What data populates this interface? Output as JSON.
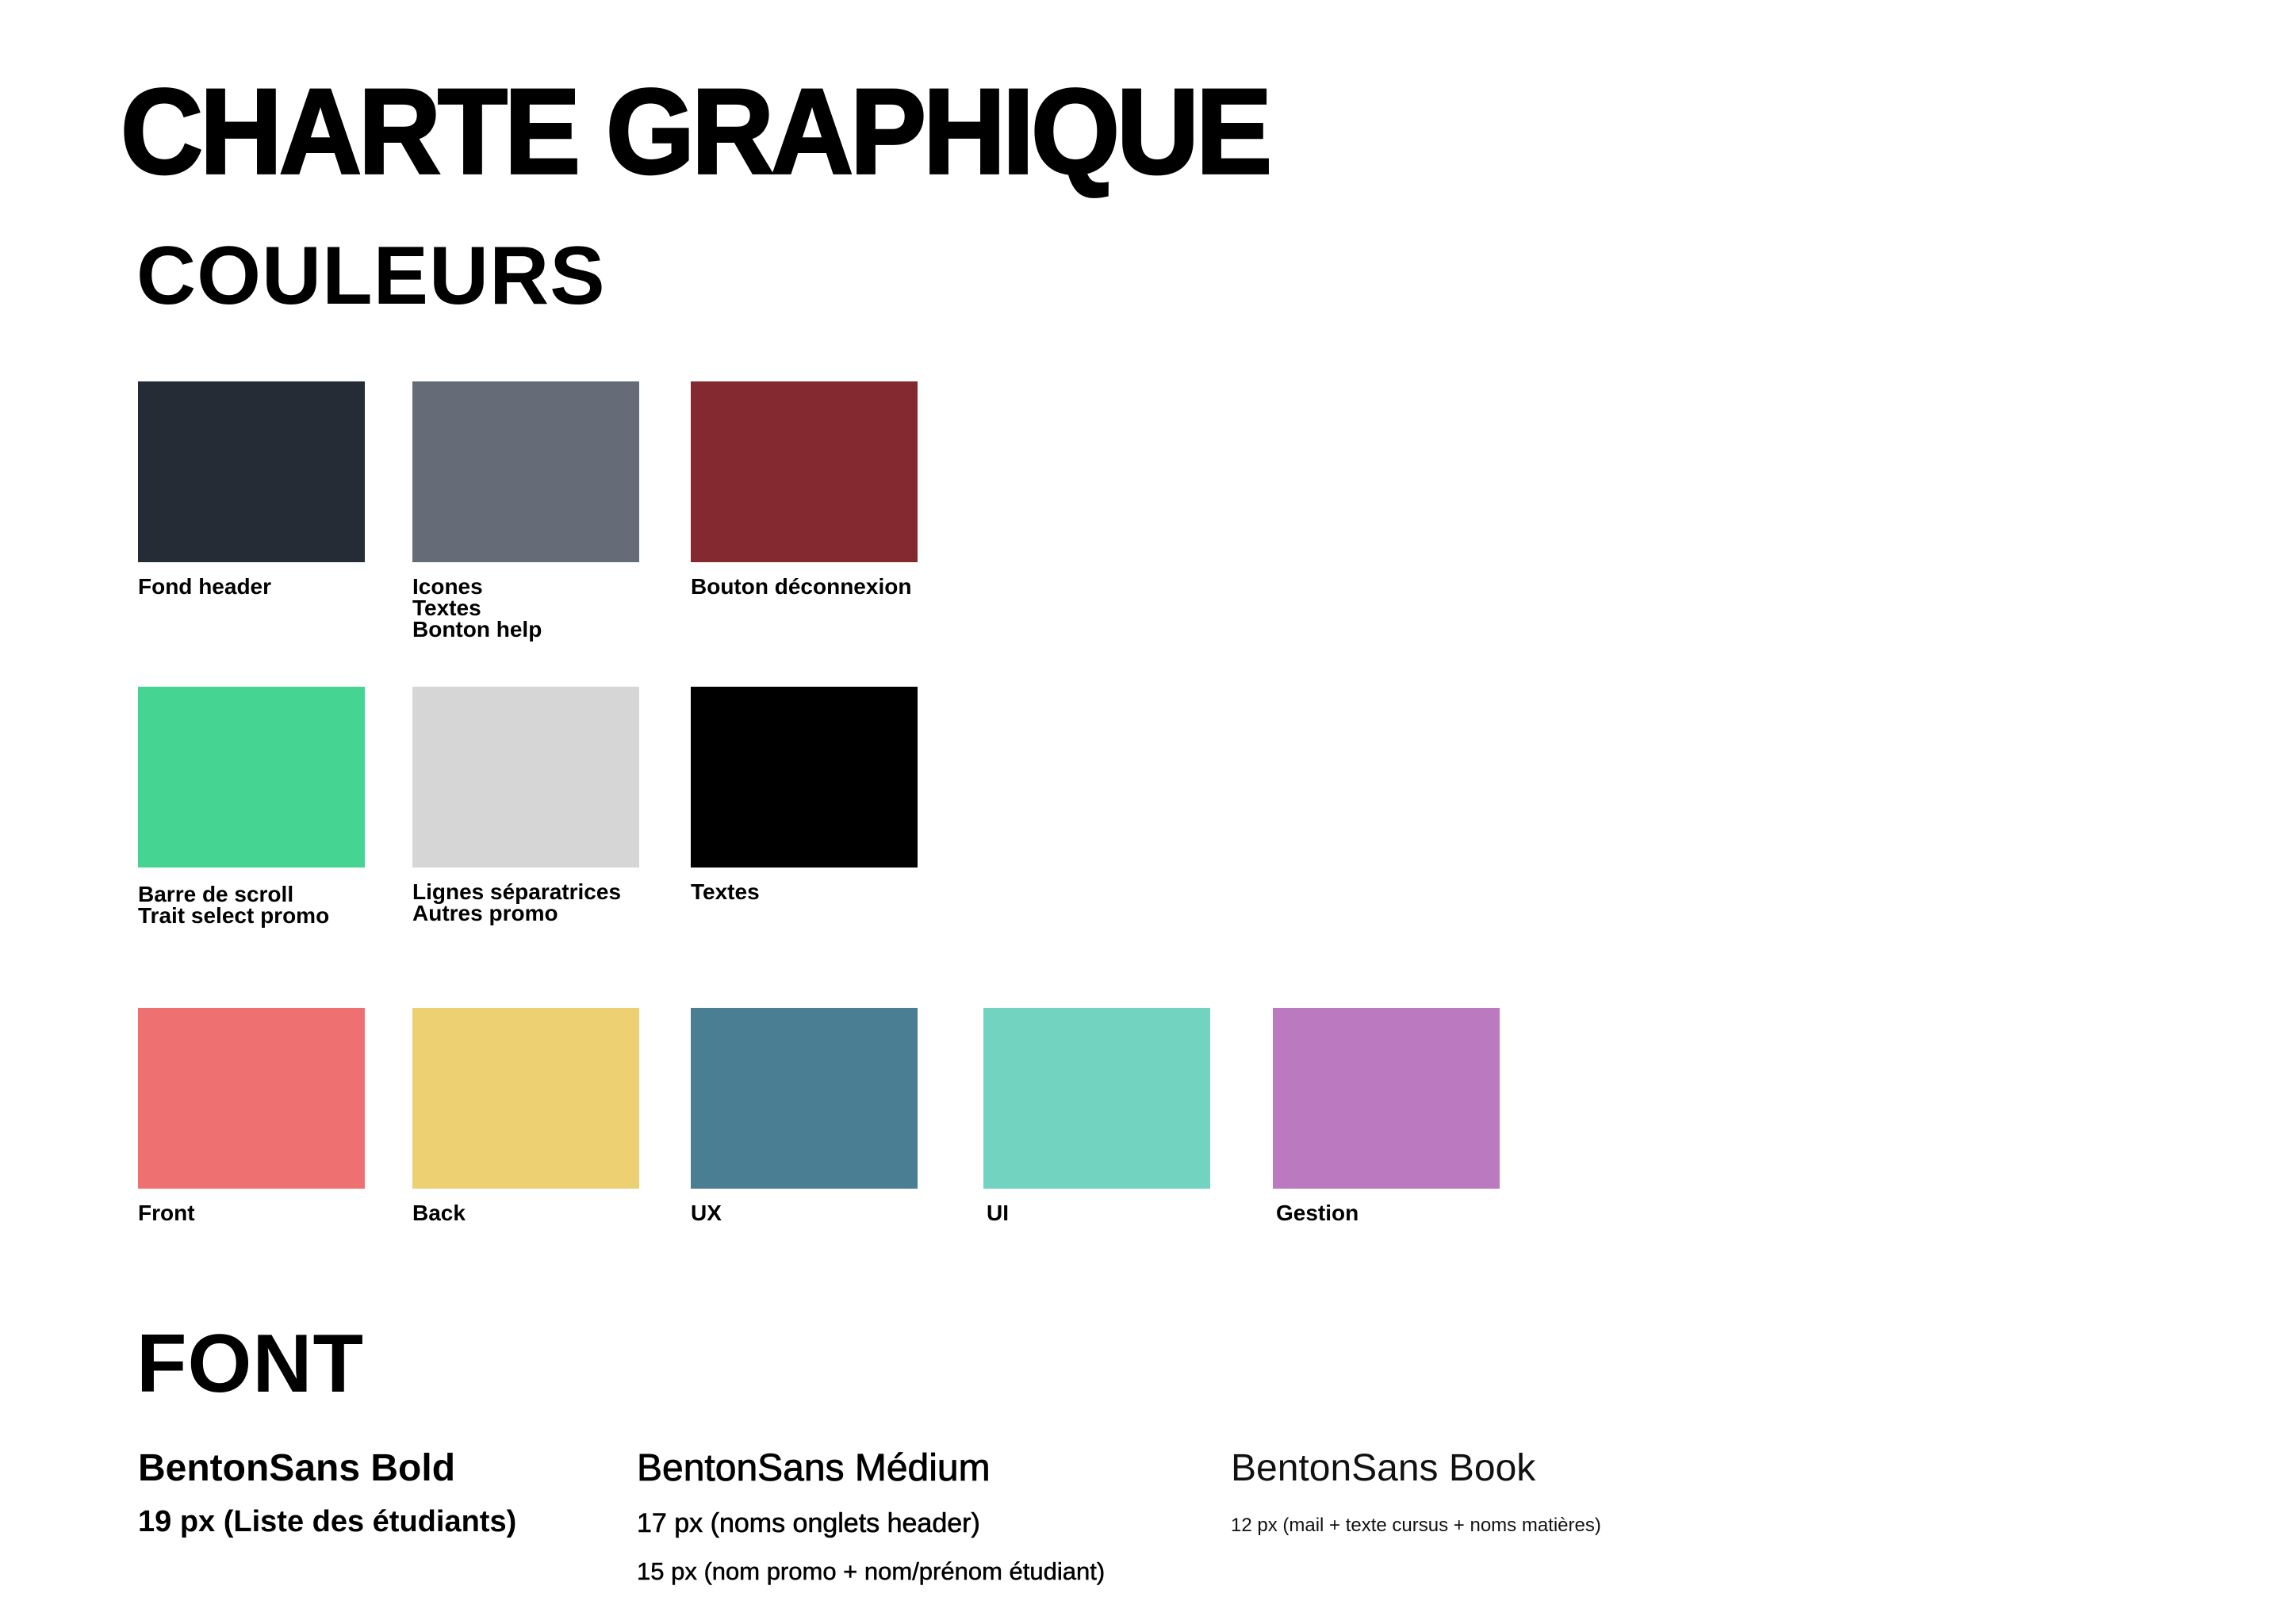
{
  "title": "CHARTE GRAPHIQUE",
  "colors_section": {
    "title": "COULEURS",
    "swatches": [
      {
        "color": "#252c36",
        "lines": [
          "Fond header"
        ]
      },
      {
        "color": "#656c78",
        "lines": [
          "Icones",
          "Textes",
          "Bonton help"
        ]
      },
      {
        "color": "#852931",
        "lines": [
          "Bouton déconnexion"
        ]
      },
      {
        "color": "#46d493",
        "lines": [
          "Barre de scroll",
          "Trait select promo"
        ]
      },
      {
        "color": "#d6d6d6",
        "lines": [
          "Lignes séparatrices",
          "Autres promo"
        ]
      },
      {
        "color": "#000000",
        "lines": [
          "Textes"
        ]
      },
      {
        "color": "#ef7070",
        "lines": [
          "Front"
        ]
      },
      {
        "color": "#ecd072",
        "lines": [
          "Back"
        ]
      },
      {
        "color": "#4a7e93",
        "lines": [
          "UX"
        ]
      },
      {
        "color": "#72d3c0",
        "lines": [
          "UI"
        ]
      },
      {
        "color": "#bb79c0",
        "lines": [
          "Gestion"
        ]
      }
    ]
  },
  "font_section": {
    "title": "FONT",
    "fonts": [
      {
        "name": "BentonSans Bold",
        "sizes": [
          "19 px (Liste des étudiants)"
        ]
      },
      {
        "name": "BentonSans Médium",
        "sizes": [
          "17 px (noms onglets header)",
          "15 px (nom promo + nom/prénom étudiant)"
        ]
      },
      {
        "name": "BentonSans Book",
        "sizes": [
          "12 px (mail + texte cursus + noms matières)"
        ]
      }
    ]
  }
}
